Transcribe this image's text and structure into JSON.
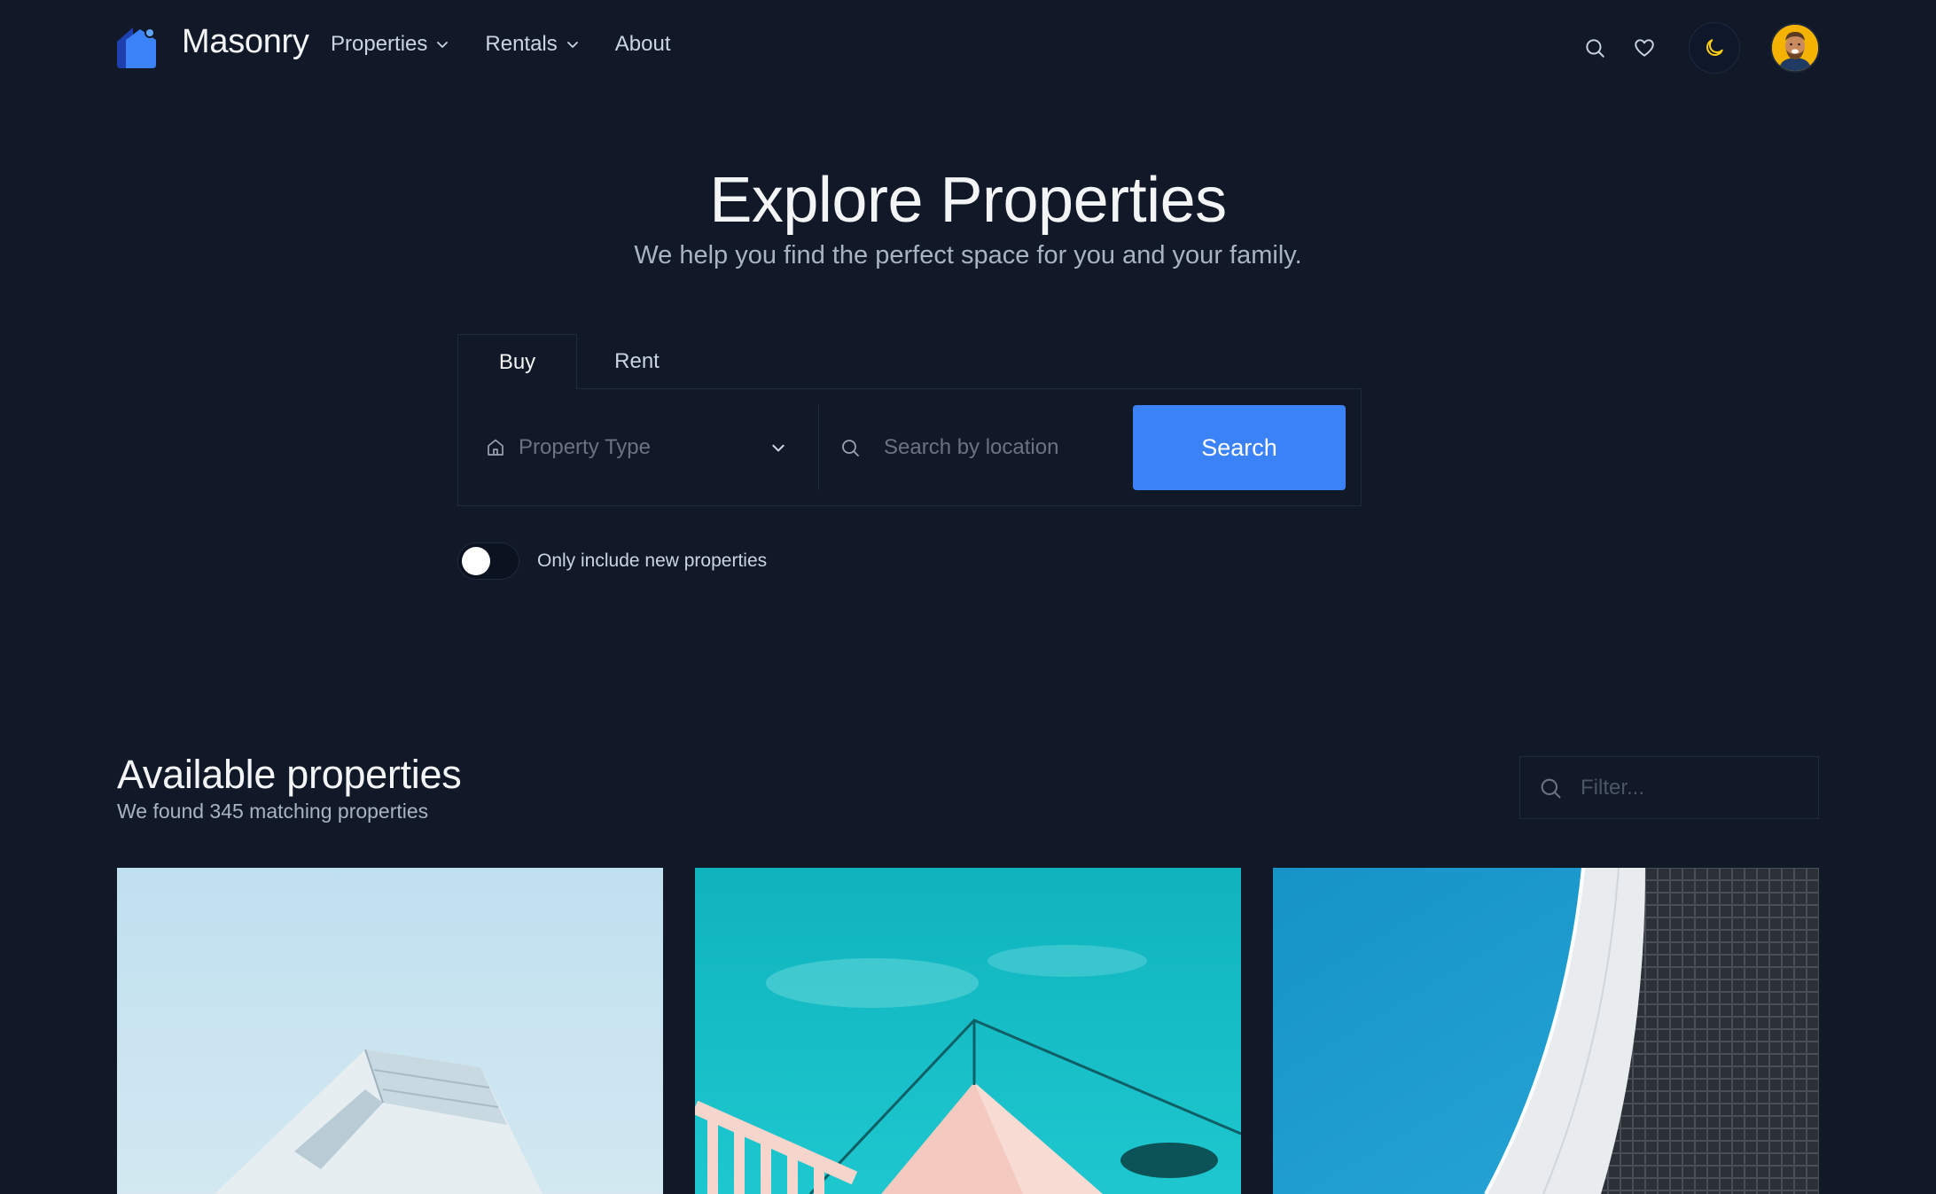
{
  "brand": {
    "name": "Masonry"
  },
  "nav": {
    "items": [
      {
        "label": "Properties",
        "has_dropdown": true
      },
      {
        "label": "Rentals",
        "has_dropdown": true
      },
      {
        "label": "About",
        "has_dropdown": false
      }
    ],
    "icons": [
      "search-icon",
      "heart-icon",
      "moon-icon"
    ]
  },
  "hero": {
    "title": "Explore Properties",
    "subtitle": "We help you find the perfect space for you and your family."
  },
  "search": {
    "tabs": [
      {
        "label": "Buy",
        "active": true
      },
      {
        "label": "Rent",
        "active": false
      }
    ],
    "property_type_placeholder": "Property Type",
    "location_placeholder": "Search by location",
    "button_label": "Search"
  },
  "toggle": {
    "label": "Only include new properties",
    "checked": false
  },
  "listing": {
    "title": "Available properties",
    "subtitle": "We found 345 matching properties",
    "filter_placeholder": "Filter..."
  },
  "colors": {
    "background": "#111827",
    "accent": "#3b82f6",
    "moon": "#facc15"
  }
}
